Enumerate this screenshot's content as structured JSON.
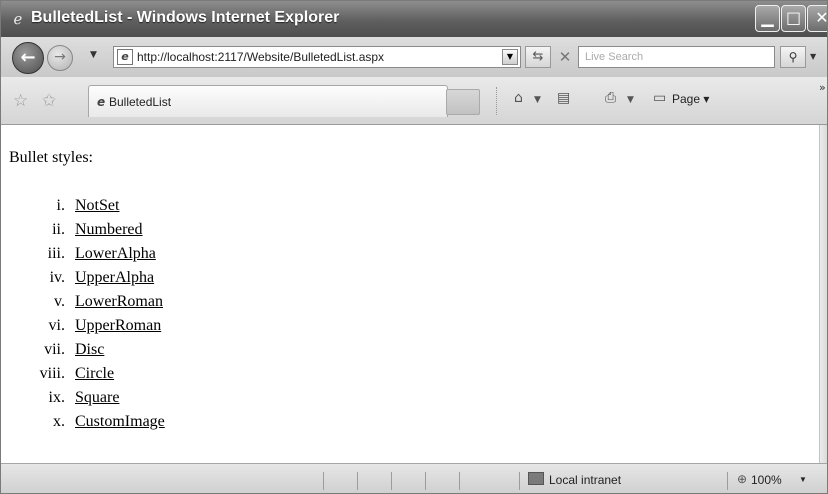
{
  "window": {
    "title": "BulletedList - Windows Internet Explorer"
  },
  "address_bar": {
    "url": "http://localhost:2117/Website/BulletedList.aspx"
  },
  "search": {
    "placeholder": "Live Search"
  },
  "tab": {
    "label": "BulletedList"
  },
  "command_bar": {
    "page_label": "Page"
  },
  "content": {
    "heading": "Bullet styles:",
    "items": [
      {
        "marker": "i.",
        "label": "NotSet"
      },
      {
        "marker": "ii.",
        "label": "Numbered"
      },
      {
        "marker": "iii.",
        "label": "LowerAlpha"
      },
      {
        "marker": "iv.",
        "label": "UpperAlpha"
      },
      {
        "marker": "v.",
        "label": "LowerRoman"
      },
      {
        "marker": "vi.",
        "label": "UpperRoman"
      },
      {
        "marker": "vii.",
        "label": "Disc"
      },
      {
        "marker": "viii.",
        "label": "Circle"
      },
      {
        "marker": "ix.",
        "label": "Square"
      },
      {
        "marker": "x.",
        "label": "CustomImage"
      }
    ]
  },
  "status_bar": {
    "zone": "Local intranet",
    "zoom": "100%"
  },
  "icons": {
    "browser": "ie-icon",
    "back": "back-arrow-icon",
    "forward": "forward-arrow-icon",
    "refresh": "refresh-icon",
    "stop": "stop-icon",
    "search": "magnifier-icon",
    "favorites": "star-icon",
    "home": "home-icon",
    "feeds": "rss-icon",
    "print": "printer-icon",
    "zone": "network-icon",
    "zoom": "zoom-icon"
  }
}
